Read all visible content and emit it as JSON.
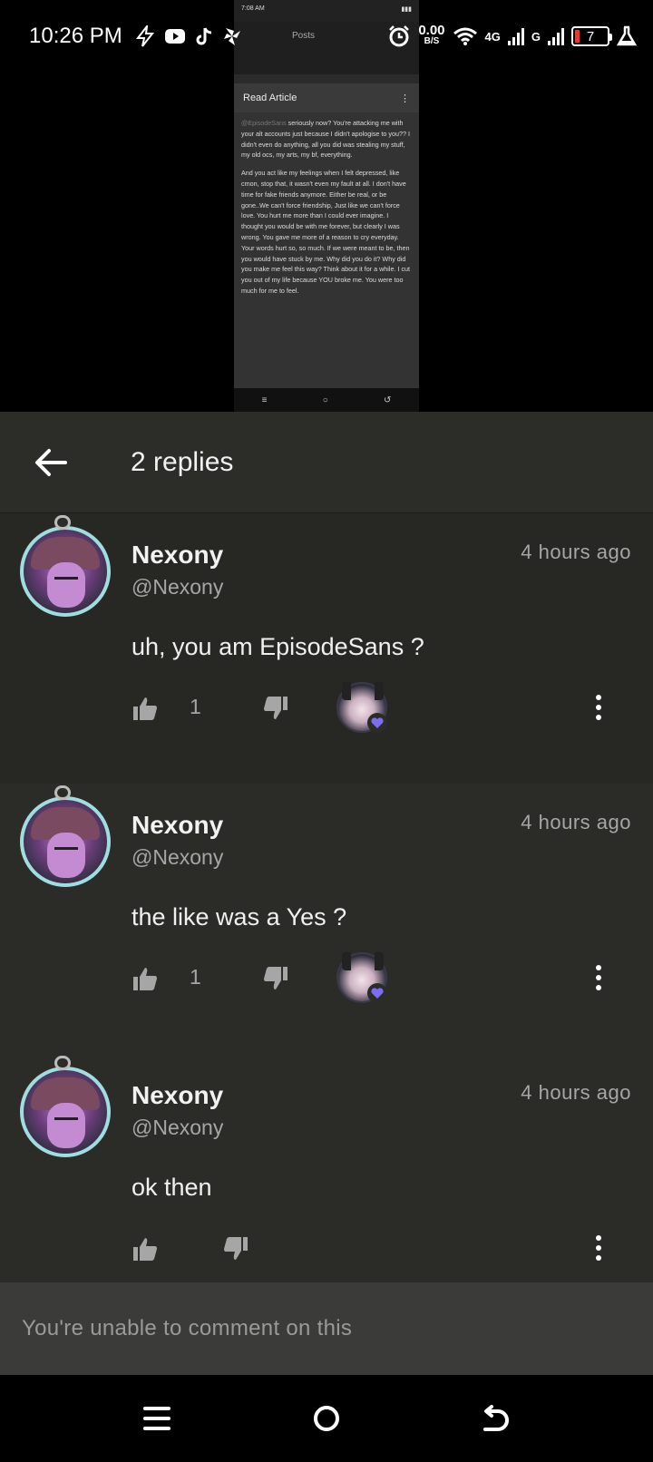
{
  "status_bar": {
    "time": "10:26 PM",
    "speed_value": "0.00",
    "speed_unit": "B/S",
    "network_4g": "4G",
    "network_g": "G",
    "battery": "7",
    "icons": [
      "flash-icon",
      "youtube-icon",
      "tiktok-icon",
      "pinwheel-icon",
      "alarm-icon",
      "wifi-icon",
      "signal-icon",
      "battery-icon",
      "flask-icon"
    ]
  },
  "preview": {
    "status_time": "7:08 AM",
    "header_title": "Posts",
    "card_title": "Read Article",
    "mention": "@EpisodeSans",
    "paragraph1": "seriously now? You're attacking me with your alt accounts just because I didn't apologise to you?? I didn't even do anything, all you did was stealing my stuff, my old ocs, my arts, my bf, everything.",
    "paragraph2": "And you act like my feelings when I felt depressed, like cmon, stop that, it wasn't even my fault at all. I don't have time for fake friends anymore. Either be real, or be gone..We can't force friendship, Just like we can't force love. You hurt me more than I could ever imagine. I thought you would be with me forever, but clearly I was wrong. You gave me more of a reason to cry everyday. Your words hurt so, so much. If we were meant to be, then you would have stuck by me. Why did you do it? Why did you make me feel this way? Think about it for a while. I cut you out of my life because YOU broke me. You were too much for me to feel."
  },
  "header": {
    "title": "2 replies"
  },
  "comments": [
    {
      "username": "Nexony",
      "handle": "@Nexony",
      "time": "4 hours ago",
      "text": "uh, you am EpisodeSans ?",
      "likes": "1"
    },
    {
      "username": "Nexony",
      "handle": "@Nexony",
      "time": "4 hours ago",
      "text": "the like was a Yes ?",
      "likes": "1"
    },
    {
      "username": "Nexony",
      "handle": "@Nexony",
      "time": "4 hours ago",
      "text": "ok then",
      "likes": ""
    }
  ],
  "footer": {
    "unable_text": "You're unable to comment on this"
  },
  "colors": {
    "background": "#2b2b28",
    "header": "#2c2d29",
    "heart": "#7c6cf0",
    "avatar_ring": "#9fdde0"
  }
}
